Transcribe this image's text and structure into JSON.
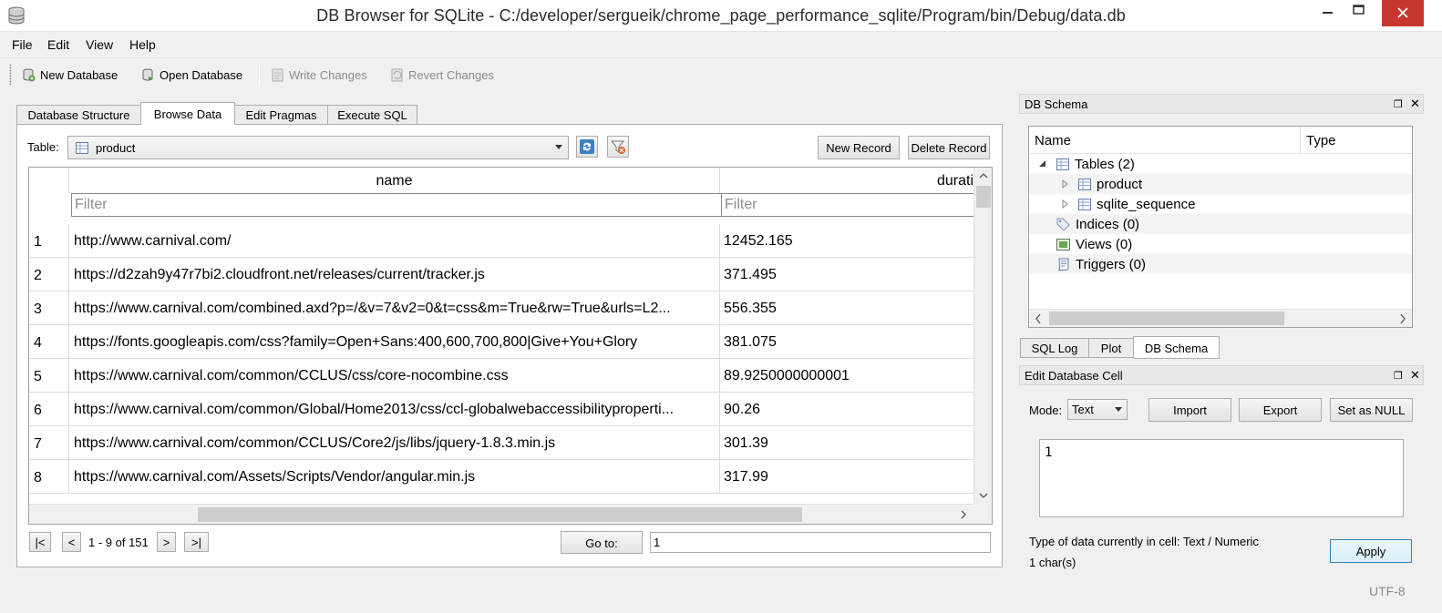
{
  "window": {
    "title": "DB Browser for SQLite - C:/developer/sergueik/chrome_page_performance_sqlite/Program/bin/Debug/data.db"
  },
  "menu": [
    "File",
    "Edit",
    "View",
    "Help"
  ],
  "toolbar": {
    "new_database": "New Database",
    "open_database": "Open Database",
    "write_changes": "Write Changes",
    "revert_changes": "Revert Changes"
  },
  "tabs": [
    "Database Structure",
    "Browse Data",
    "Edit Pragmas",
    "Execute SQL"
  ],
  "active_tab": "Browse Data",
  "browse": {
    "table_label": "Table:",
    "table_selected": "product",
    "new_record": "New Record",
    "delete_record": "Delete Record",
    "columns": [
      "name",
      "durati"
    ],
    "filter_placeholder": "Filter",
    "rows": [
      {
        "idx": "1",
        "name": "http://www.carnival.com/",
        "duration": "12452.165"
      },
      {
        "idx": "2",
        "name": "https://d2zah9y47r7bi2.cloudfront.net/releases/current/tracker.js",
        "duration": "371.495"
      },
      {
        "idx": "3",
        "name": "https://www.carnival.com/combined.axd?p=/&v=7&v2=0&t=css&m=True&rw=True&urls=L2...",
        "duration": "556.355"
      },
      {
        "idx": "4",
        "name": "https://fonts.googleapis.com/css?family=Open+Sans:400,600,700,800|Give+You+Glory",
        "duration": "381.075"
      },
      {
        "idx": "5",
        "name": "https://www.carnival.com/common/CCLUS/css/core-nocombine.css",
        "duration": "89.9250000000001"
      },
      {
        "idx": "6",
        "name": "https://www.carnival.com/common/Global/Home2013/css/ccl-globalwebaccessibilityproperti...",
        "duration": "90.26"
      },
      {
        "idx": "7",
        "name": "https://www.carnival.com/common/CCLUS/Core2/js/libs/jquery-1.8.3.min.js",
        "duration": "301.39"
      },
      {
        "idx": "8",
        "name": "https://www.carnival.com/Assets/Scripts/Vendor/angular.min.js",
        "duration": "317.99"
      }
    ],
    "pagination": {
      "first": "|<",
      "prev": "<",
      "info": "1 - 9 of 151",
      "next": ">",
      "last": ">|",
      "goto_label": "Go to:",
      "goto_value": "1"
    }
  },
  "schema_dock": {
    "title": "DB Schema",
    "col_name": "Name",
    "col_type": "Type",
    "tree": {
      "tables": "Tables (2)",
      "product": "product",
      "sqlite_sequence": "sqlite_sequence",
      "indices": "Indices (0)",
      "views": "Views (0)",
      "triggers": "Triggers (0)"
    }
  },
  "dock_tabs": [
    "SQL Log",
    "Plot",
    "DB Schema"
  ],
  "edit_cell": {
    "title": "Edit Database Cell",
    "mode_label": "Mode:",
    "mode_value": "Text",
    "import": "Import",
    "export": "Export",
    "set_null": "Set as NULL",
    "value": "1",
    "type_info": "Type of data currently in cell: Text / Numeric",
    "chars": "1 char(s)",
    "apply": "Apply"
  },
  "status": {
    "encoding": "UTF-8"
  },
  "colors": {
    "close_button": "#c7372f",
    "apply_border": "#3c7fb1"
  }
}
